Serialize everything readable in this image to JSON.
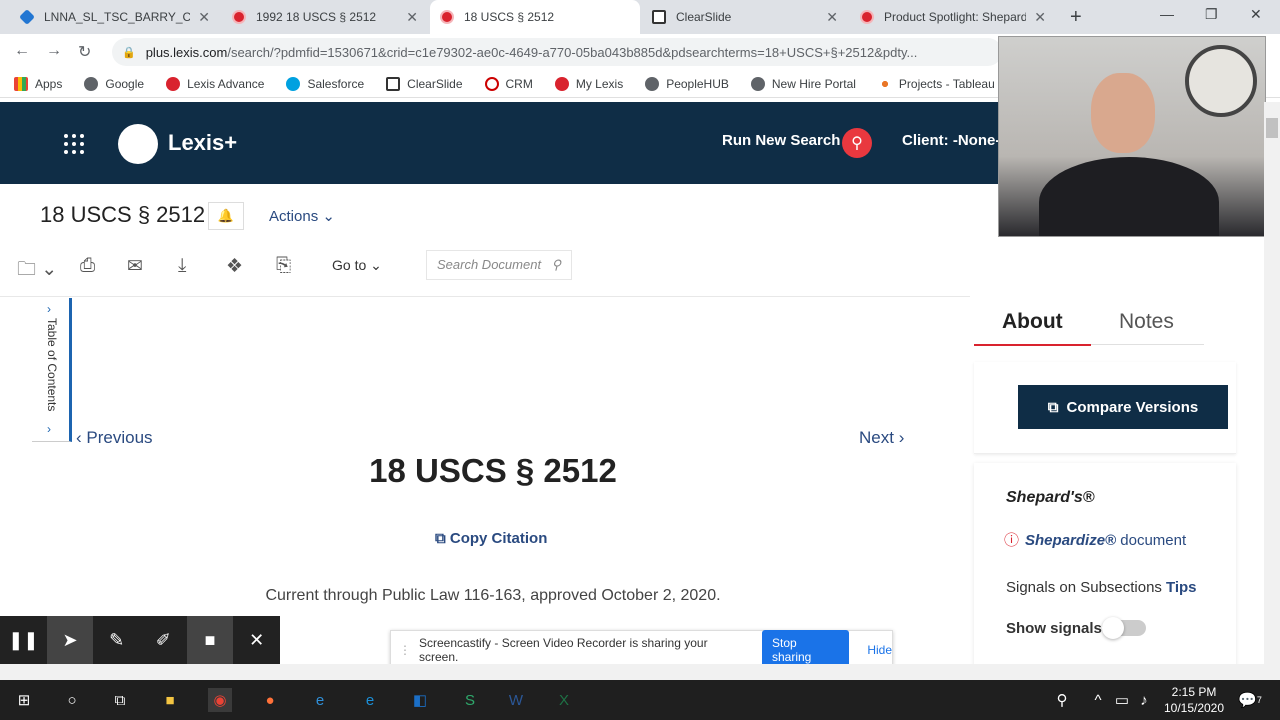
{
  "browser": {
    "tabs": [
      {
        "title": "LNNA_SL_TSC_BARRY_C_OF",
        "favicon": "salesforce-icon"
      },
      {
        "title": "1992 18 USCS § 2512",
        "favicon": "lexis-icon"
      },
      {
        "title": "18 USCS § 2512",
        "favicon": "lexis-icon",
        "active": true
      },
      {
        "title": "ClearSlide",
        "favicon": "clearslide-icon"
      },
      {
        "title": "Product Spotlight: Shepard",
        "favicon": "lexis-icon"
      }
    ],
    "url_host": "plus.lexis.com",
    "url_rest": "/search/?pdmfid=1530671&crid=c1e79302-ae0c-4649-a770-05ba043b885d&pdsearchterms=18+USCS+§+2512&pdty...",
    "bookmarks": [
      "Apps",
      "Google",
      "Lexis Advance",
      "Salesforce",
      "ClearSlide",
      "CRM",
      "My Lexis",
      "PeopleHUB",
      "New Hire Portal",
      "Projects - Tableau S..."
    ]
  },
  "header": {
    "logo": "Lexis+",
    "run_search": "Run New Search",
    "client": "Client: -None-"
  },
  "doc": {
    "title": "18 USCS § 2512",
    "actions": "Actions",
    "goto": "Go to",
    "search_placeholder": "Search Document",
    "toc": "Table of Contents",
    "prev": "Previous",
    "next": "Next",
    "main_title": "18 USCS § 2512",
    "copy_citation": "Copy Citation",
    "current_through": "Current through Public Law 116-163, approved October 2, 2020."
  },
  "panel": {
    "tab_about": "About",
    "tab_notes": "Notes",
    "compare": "Compare Versions",
    "shepards": "Shepard's®",
    "shepardize": "Shepardize®",
    "document": "document",
    "signals": "Signals on Subsections",
    "tips": "Tips",
    "show_signals": "Show signals"
  },
  "screencastify": {
    "message": "Screencastify - Screen Video Recorder is sharing your screen.",
    "stop": "Stop sharing",
    "hide": "Hide"
  },
  "taskbar": {
    "time": "2:15 PM",
    "date": "10/15/2020",
    "notifications": "7"
  },
  "colors": {
    "lexis_navy": "#0f2d46",
    "lexis_red": "#d9232e",
    "link_blue": "#2a4a80"
  }
}
